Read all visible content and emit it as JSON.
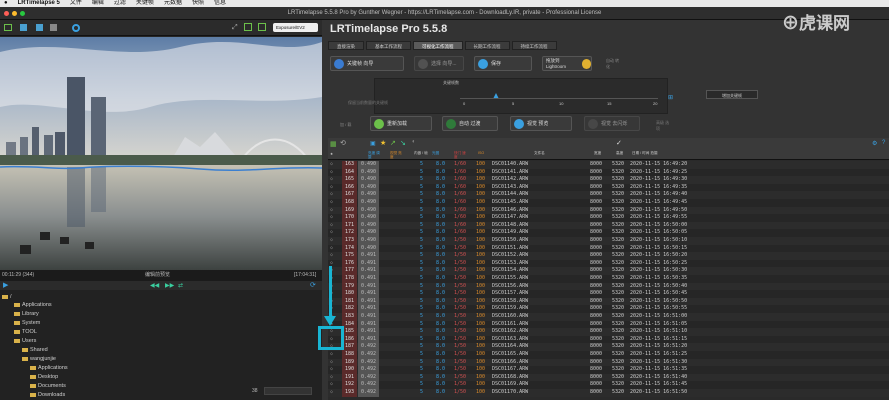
{
  "menubar": {
    "app": "LRTimelapse 5",
    "items": [
      "文件",
      "编辑",
      "过滤",
      "关键帧",
      "元数据",
      "快照",
      "信息"
    ]
  },
  "window": {
    "title": "LRTimelapse 5.5.8 Pro by Gunther Wegner - https://LRTimelapse.com - DownloadLy.IR, private - Professional License"
  },
  "left_panel": {
    "preview_dropdown": "Exposure/EV2",
    "frame_left": "00:11:29 (344)",
    "frame_center": "编辑前预览",
    "frame_right": "[17:04:31]",
    "tree": [
      {
        "label": "/",
        "depth": 0
      },
      {
        "label": "Applications",
        "depth": 1
      },
      {
        "label": "Library",
        "depth": 1
      },
      {
        "label": "System",
        "depth": 1
      },
      {
        "label": "TOOL",
        "depth": 1
      },
      {
        "label": "Users",
        "depth": 1
      },
      {
        "label": "Shared",
        "depth": 2
      },
      {
        "label": "wangjunjie",
        "depth": 2
      },
      {
        "label": "Applications",
        "depth": 3
      },
      {
        "label": "Desktop",
        "depth": 3
      },
      {
        "label": "Documents",
        "depth": 3
      },
      {
        "label": "Downloads",
        "depth": 3
      }
    ],
    "footer_count": "38"
  },
  "right_panel": {
    "brand": "LRTimelapse Pro 5.5.8",
    "tabs": [
      "直接渲染",
      "基本工作流程",
      "可视化工作流程",
      "长期工作流程",
      "持续工作流程"
    ],
    "active_tab": 2,
    "toolbar1": {
      "keyframe_wizard": "关键帧 向导",
      "select": "选择 向导...",
      "save": "保存",
      "dragdrop": "拖放到 Lightroom",
      "auto": "自动 转化"
    },
    "slider": {
      "label": "关键帧数",
      "ticks": [
        "0",
        "5",
        "10",
        "15",
        "20"
      ],
      "hint": "保留当前数量的关键帧",
      "add_button": "增加关键帧"
    },
    "toolbar2": {
      "side_label": "加 / 载",
      "reload": "重新加载",
      "auto_transition": "自动 过渡",
      "visual_preview": "视觉 预览",
      "visual_deflicker": "视觉 去闪烁",
      "more": "高级 选项"
    },
    "table_headers": [
      "★",
      "亮度 调整",
      "视觉 亮度",
      "内嵌 / 帧",
      "光圈",
      "快门 速度",
      "ISO",
      "文件名",
      "宽度",
      "高度",
      "日期 / 时间 拍摄"
    ],
    "rows": [
      {
        "n": "163",
        "v": "0.490",
        "a": "5",
        "f": "8.0",
        "s": "1/60",
        "iso": "100",
        "file": "DSC01140.ARW",
        "w": "8000",
        "h": "5320",
        "d": "2020-11-15 16:49:20"
      },
      {
        "n": "164",
        "v": "0.490",
        "a": "5",
        "f": "8.0",
        "s": "1/60",
        "iso": "100",
        "file": "DSC01141.ARW",
        "w": "8000",
        "h": "5320",
        "d": "2020-11-15 16:49:25"
      },
      {
        "n": "165",
        "v": "0.490",
        "a": "5",
        "f": "8.0",
        "s": "1/60",
        "iso": "100",
        "file": "DSC01142.ARW",
        "w": "8000",
        "h": "5320",
        "d": "2020-11-15 16:49:30"
      },
      {
        "n": "166",
        "v": "0.490",
        "a": "5",
        "f": "8.0",
        "s": "1/60",
        "iso": "100",
        "file": "DSC01143.ARW",
        "w": "8000",
        "h": "5320",
        "d": "2020-11-15 16:49:35"
      },
      {
        "n": "167",
        "v": "0.490",
        "a": "5",
        "f": "8.0",
        "s": "1/60",
        "iso": "100",
        "file": "DSC01144.ARW",
        "w": "8000",
        "h": "5320",
        "d": "2020-11-15 16:49:40"
      },
      {
        "n": "168",
        "v": "0.490",
        "a": "5",
        "f": "8.0",
        "s": "1/60",
        "iso": "100",
        "file": "DSC01145.ARW",
        "w": "8000",
        "h": "5320",
        "d": "2020-11-15 16:49:45"
      },
      {
        "n": "169",
        "v": "0.490",
        "a": "5",
        "f": "8.0",
        "s": "1/60",
        "iso": "100",
        "file": "DSC01146.ARW",
        "w": "8000",
        "h": "5320",
        "d": "2020-11-15 16:49:50"
      },
      {
        "n": "170",
        "v": "0.490",
        "a": "5",
        "f": "8.0",
        "s": "1/60",
        "iso": "100",
        "file": "DSC01147.ARW",
        "w": "8000",
        "h": "5320",
        "d": "2020-11-15 16:49:55"
      },
      {
        "n": "171",
        "v": "0.490",
        "a": "5",
        "f": "8.0",
        "s": "1/60",
        "iso": "100",
        "file": "DSC01148.ARW",
        "w": "8000",
        "h": "5320",
        "d": "2020-11-15 16:50:00"
      },
      {
        "n": "172",
        "v": "0.490",
        "a": "5",
        "f": "8.0",
        "s": "1/60",
        "iso": "100",
        "file": "DSC01149.ARW",
        "w": "8000",
        "h": "5320",
        "d": "2020-11-15 16:50:05"
      },
      {
        "n": "173",
        "v": "0.490",
        "a": "5",
        "f": "8.0",
        "s": "1/50",
        "iso": "100",
        "file": "DSC01150.ARW",
        "w": "8000",
        "h": "5320",
        "d": "2020-11-15 16:50:10"
      },
      {
        "n": "174",
        "v": "0.490",
        "a": "5",
        "f": "8.0",
        "s": "1/50",
        "iso": "100",
        "file": "DSC01151.ARW",
        "w": "8000",
        "h": "5320",
        "d": "2020-11-15 16:50:15"
      },
      {
        "n": "175",
        "v": "0.491",
        "a": "5",
        "f": "8.0",
        "s": "1/50",
        "iso": "100",
        "file": "DSC01152.ARW",
        "w": "8000",
        "h": "5320",
        "d": "2020-11-15 16:50:20"
      },
      {
        "n": "176",
        "v": "0.491",
        "a": "5",
        "f": "8.0",
        "s": "1/50",
        "iso": "100",
        "file": "DSC01153.ARW",
        "w": "8000",
        "h": "5320",
        "d": "2020-11-15 16:50:25"
      },
      {
        "n": "177",
        "v": "0.491",
        "a": "5",
        "f": "8.0",
        "s": "1/50",
        "iso": "100",
        "file": "DSC01154.ARW",
        "w": "8000",
        "h": "5320",
        "d": "2020-11-15 16:50:30"
      },
      {
        "n": "178",
        "v": "0.491",
        "a": "5",
        "f": "8.0",
        "s": "1/50",
        "iso": "100",
        "file": "DSC01155.ARW",
        "w": "8000",
        "h": "5320",
        "d": "2020-11-15 16:50:35"
      },
      {
        "n": "179",
        "v": "0.491",
        "a": "5",
        "f": "8.0",
        "s": "1/50",
        "iso": "100",
        "file": "DSC01156.ARW",
        "w": "8000",
        "h": "5320",
        "d": "2020-11-15 16:50:40"
      },
      {
        "n": "180",
        "v": "0.491",
        "a": "5",
        "f": "8.0",
        "s": "1/50",
        "iso": "100",
        "file": "DSC01157.ARW",
        "w": "8000",
        "h": "5320",
        "d": "2020-11-15 16:50:45"
      },
      {
        "n": "181",
        "v": "0.491",
        "a": "5",
        "f": "8.0",
        "s": "1/50",
        "iso": "100",
        "file": "DSC01158.ARW",
        "w": "8000",
        "h": "5320",
        "d": "2020-11-15 16:50:50"
      },
      {
        "n": "182",
        "v": "0.491",
        "a": "5",
        "f": "8.0",
        "s": "1/50",
        "iso": "100",
        "file": "DSC01159.ARW",
        "w": "8000",
        "h": "5320",
        "d": "2020-11-15 16:50:55"
      },
      {
        "n": "183",
        "v": "0.491",
        "a": "5",
        "f": "8.0",
        "s": "1/50",
        "iso": "100",
        "file": "DSC01160.ARW",
        "w": "8000",
        "h": "5320",
        "d": "2020-11-15 16:51:00"
      },
      {
        "n": "184",
        "v": "0.491",
        "a": "5",
        "f": "8.0",
        "s": "1/50",
        "iso": "100",
        "file": "DSC01161.ARW",
        "w": "8000",
        "h": "5320",
        "d": "2020-11-15 16:51:05"
      },
      {
        "n": "185",
        "v": "0.491",
        "a": "5",
        "f": "8.0",
        "s": "1/50",
        "iso": "100",
        "file": "DSC01162.ARW",
        "w": "8000",
        "h": "5320",
        "d": "2020-11-15 16:51:10"
      },
      {
        "n": "186",
        "v": "0.491",
        "a": "5",
        "f": "8.0",
        "s": "1/50",
        "iso": "100",
        "file": "DSC01163.ARW",
        "w": "8000",
        "h": "5320",
        "d": "2020-11-15 16:51:15"
      },
      {
        "n": "187",
        "v": "0.492",
        "a": "5",
        "f": "8.0",
        "s": "1/50",
        "iso": "100",
        "file": "DSC01164.ARW",
        "w": "8000",
        "h": "5320",
        "d": "2020-11-15 16:51:20"
      },
      {
        "n": "188",
        "v": "0.492",
        "a": "5",
        "f": "8.0",
        "s": "1/50",
        "iso": "100",
        "file": "DSC01165.ARW",
        "w": "8000",
        "h": "5320",
        "d": "2020-11-15 16:51:25"
      },
      {
        "n": "189",
        "v": "0.492",
        "a": "5",
        "f": "8.0",
        "s": "1/50",
        "iso": "100",
        "file": "DSC01166.ARW",
        "w": "8000",
        "h": "5320",
        "d": "2020-11-15 16:51:30"
      },
      {
        "n": "190",
        "v": "0.492",
        "a": "5",
        "f": "8.0",
        "s": "1/50",
        "iso": "100",
        "file": "DSC01167.ARW",
        "w": "8000",
        "h": "5320",
        "d": "2020-11-15 16:51:35"
      },
      {
        "n": "191",
        "v": "0.492",
        "a": "5",
        "f": "8.0",
        "s": "1/50",
        "iso": "100",
        "file": "DSC01168.ARW",
        "w": "8000",
        "h": "5320",
        "d": "2020-11-15 16:51:40"
      },
      {
        "n": "192",
        "v": "0.492",
        "a": "5",
        "f": "8.0",
        "s": "1/50",
        "iso": "100",
        "file": "DSC01169.ARW",
        "w": "8000",
        "h": "5320",
        "d": "2020-11-15 16:51:45"
      },
      {
        "n": "193",
        "v": "0.492",
        "a": "5",
        "f": "8.0",
        "s": "1/50",
        "iso": "100",
        "file": "DSC01170.ARW",
        "w": "8000",
        "h": "5320",
        "d": "2020-11-15 16:51:50"
      }
    ]
  },
  "colors": {
    "accent": "#19b5d3",
    "keyframe_col": "#7a3030",
    "orange": "#d98a2a"
  }
}
